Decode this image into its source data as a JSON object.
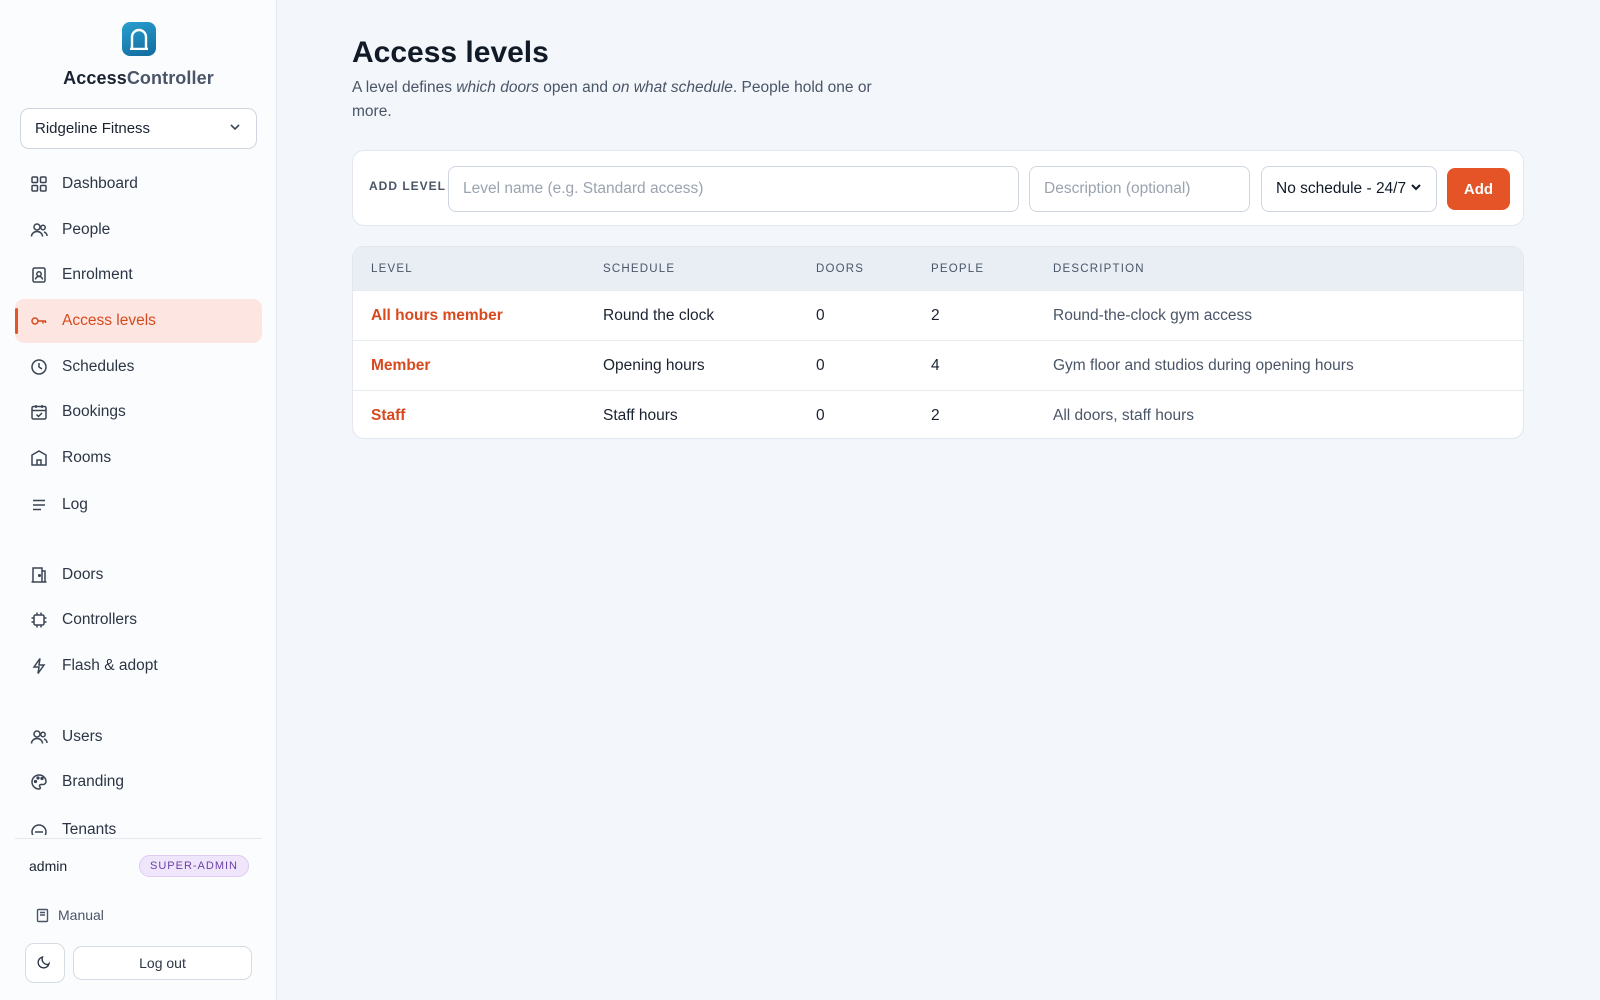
{
  "brand": {
    "name_part1": "Access",
    "name_part2": "Controller"
  },
  "tenant": {
    "selected": "Ridgeline Fitness"
  },
  "sidebar": {
    "items": [
      {
        "label": "Dashboard",
        "icon": "grid-icon"
      },
      {
        "label": "People",
        "icon": "people-icon"
      },
      {
        "label": "Enrolment",
        "icon": "badge-icon"
      },
      {
        "label": "Access levels",
        "icon": "key-icon",
        "active": true
      },
      {
        "label": "Schedules",
        "icon": "clock-icon"
      },
      {
        "label": "Bookings",
        "icon": "calendar-check-icon"
      },
      {
        "label": "Rooms",
        "icon": "building-icon"
      },
      {
        "label": "Log",
        "icon": "list-icon"
      },
      {
        "label": "Doors",
        "icon": "door-icon"
      },
      {
        "label": "Controllers",
        "icon": "chip-icon"
      },
      {
        "label": "Flash & adopt",
        "icon": "bolt-icon"
      },
      {
        "label": "Users",
        "icon": "users-icon"
      },
      {
        "label": "Branding",
        "icon": "palette-icon"
      },
      {
        "label": "Tenants",
        "icon": "tenants-icon"
      }
    ]
  },
  "footer": {
    "user": "admin",
    "role": "SUPER-ADMIN",
    "manual_label": "Manual",
    "logout_label": "Log out"
  },
  "page": {
    "title": "Access levels",
    "subtitle_a": "A level defines ",
    "subtitle_b": "which doors",
    "subtitle_c": " open and ",
    "subtitle_d": "on what schedule",
    "subtitle_e": ". People hold one or more."
  },
  "add_level": {
    "label": "ADD LEVEL",
    "name_placeholder": "Level name (e.g. Standard access)",
    "desc_placeholder": "Description (optional)",
    "schedule_selected": "No schedule - 24/7",
    "add_label": "Add"
  },
  "table": {
    "headers": [
      "LEVEL",
      "SCHEDULE",
      "DOORS",
      "PEOPLE",
      "DESCRIPTION"
    ],
    "rows": [
      {
        "level": "All hours member",
        "schedule": "Round the clock",
        "doors": "0",
        "people": "2",
        "description": "Round-the-clock gym access"
      },
      {
        "level": "Member",
        "schedule": "Opening hours",
        "doors": "0",
        "people": "4",
        "description": "Gym floor and studios during opening hours"
      },
      {
        "level": "Staff",
        "schedule": "Staff hours",
        "doors": "0",
        "people": "2",
        "description": "All doors, staff hours"
      }
    ]
  },
  "colors": {
    "accent": "#e55427",
    "active_bg": "#fde6e1",
    "logo": "#1a86b8"
  }
}
